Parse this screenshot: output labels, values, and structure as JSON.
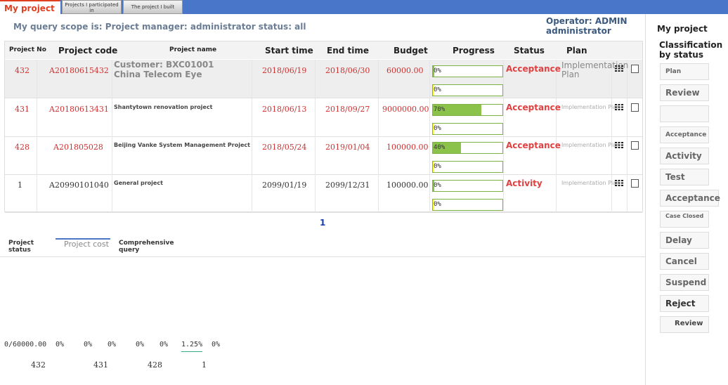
{
  "tabs": [
    {
      "label": "My project"
    },
    {
      "label": "Projects I participated in"
    },
    {
      "label": "The project I built"
    }
  ],
  "scope_text": "My query scope is: Project manager: administrator status: all",
  "operator": {
    "line1": "Operator: ADMIN",
    "line2": "administrator"
  },
  "table": {
    "headers": [
      "Project No",
      "Project code",
      "Project name",
      "Start time",
      "End time",
      "Budget",
      "Progress",
      "Status",
      "Plan"
    ],
    "rows": [
      {
        "no": "432",
        "code": "A20180615432",
        "name": "Customer: BXC01001 China Telecom Eye",
        "start": "2018/06/19",
        "end": "2018/06/30",
        "budget": "60000.00",
        "p1": "0%",
        "p1_value": 0.02,
        "p2": "0%",
        "p2_value": 0.02,
        "status": "Acceptance",
        "plan": "Implementation Plan"
      },
      {
        "no": "431",
        "code": "A20180613431",
        "name": "Shantytown renovation project",
        "start": "2018/06/13",
        "end": "2018/09/27",
        "budget": "9000000.00",
        "p1": "70%",
        "p1_value": 0.7,
        "p2": "0%",
        "p2_value": 0.02,
        "status": "Acceptance",
        "plan": "Implementation Plan"
      },
      {
        "no": "428",
        "code": "A201805028",
        "name": "Beijing Vanke System Management Project",
        "start": "2018/05/24",
        "end": "2019/01/04",
        "budget": "100000.00",
        "p1": "40%",
        "p1_value": 0.4,
        "p2": "0%",
        "p2_value": 0.02,
        "status": "Acceptance",
        "plan": "Implementation Plan"
      },
      {
        "no": "1",
        "code": "A20990101040",
        "name": "General project",
        "start": "2099/01/19",
        "end": "2099/12/31",
        "budget": "100000.00",
        "p1": "0%",
        "p1_value": 0.02,
        "p2": "0%",
        "p2_value": 0.02,
        "status": "Activity",
        "plan": "Implementation Plan"
      }
    ]
  },
  "pager": {
    "current": "1"
  },
  "bottom_tabs": [
    {
      "label": "Project status"
    },
    {
      "label": "Project cost"
    },
    {
      "label": "Comprehensive query"
    }
  ],
  "cost_values": [
    "0/60000.00",
    "0%",
    "0%",
    "0%",
    "0%",
    "0%",
    "1.25%",
    "0%"
  ],
  "cost_ids": [
    "432",
    "431",
    "428",
    "1"
  ],
  "side": {
    "title": "My project",
    "subtitle": "Classification by status",
    "buttons": [
      "Plan",
      "Review",
      "",
      "Acceptance",
      "Activity",
      "Test",
      "Acceptance",
      "Case Closed",
      "Delay",
      "Cancel",
      "Suspend",
      "Reject",
      "Review"
    ]
  },
  "colors": {
    "accent_red": "#e04040",
    "tab_blue": "#4a76c9",
    "progress_green": "#8bc34a",
    "progress_yellow": "#ffff33"
  }
}
